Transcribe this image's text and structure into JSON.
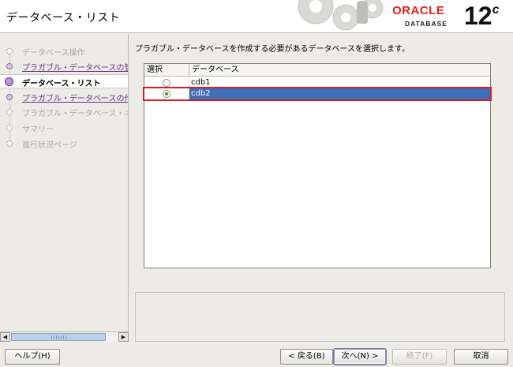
{
  "window": {
    "title": "データベース・リスト"
  },
  "branding": {
    "oracle": "ORACLE",
    "database": "DATABASE",
    "version": "12",
    "version_suffix": "c",
    "accent": "#e0201b"
  },
  "nav": {
    "items": [
      {
        "label": "データベース操作",
        "state": "done"
      },
      {
        "label": "プラガブル・データベースの管",
        "state": "link"
      },
      {
        "label": "データベース・リスト",
        "state": "active"
      },
      {
        "label": "プラガブル・データベースの作",
        "state": "link"
      },
      {
        "label": "プラガブル・データベース・オ",
        "state": "pending"
      },
      {
        "label": "サマリー",
        "state": "pending"
      },
      {
        "label": "進行状況ページ",
        "state": "pending"
      }
    ]
  },
  "main": {
    "instruction": "プラガブル・データベースを作成する必要があるデータベースを選択します。",
    "table": {
      "columns": [
        "選択",
        "データベース"
      ],
      "rows": [
        {
          "selected": false,
          "database": "cdb1"
        },
        {
          "selected": true,
          "database": "cdb2"
        }
      ]
    }
  },
  "buttons": {
    "help": "ヘルプ(H)",
    "back": "< 戻る(B)",
    "next": "次へ(N) >",
    "finish": "終了(F)",
    "cancel": "取消"
  },
  "colors": {
    "selection": "#3d6eb8",
    "highlight_box": "#e21b23",
    "nav_link": "#6a2d8c"
  }
}
